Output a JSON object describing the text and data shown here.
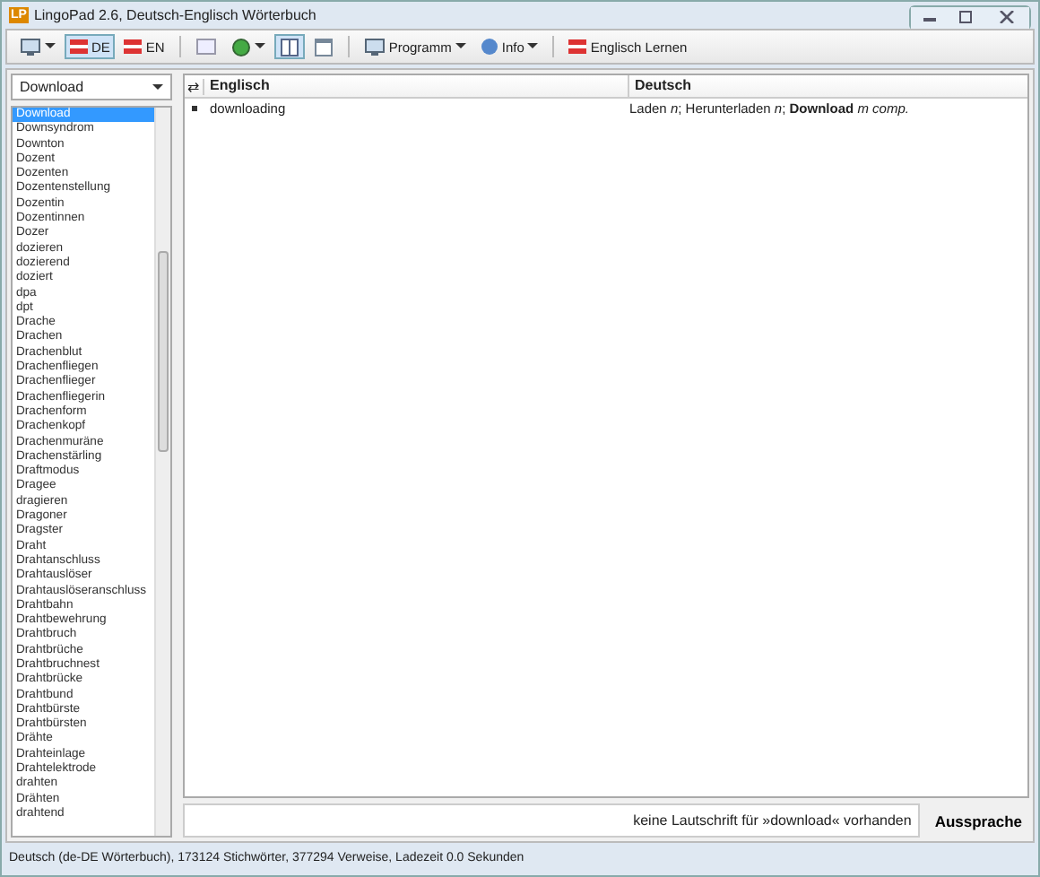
{
  "window": {
    "title": "LingoPad 2.6, Deutsch-Englisch Wörterbuch",
    "app_badge": "LP"
  },
  "toolbar": [
    {
      "kind": "icon-menu",
      "selected": false
    },
    {
      "kind": "lang",
      "label": "DE",
      "selected": true
    },
    {
      "kind": "lang",
      "label": "EN",
      "selected": false
    },
    {
      "kind": "sep"
    },
    {
      "kind": "icon",
      "selected": false
    },
    {
      "kind": "icon-menu",
      "selected": false
    },
    {
      "kind": "icon",
      "selected": true
    },
    {
      "kind": "icon",
      "selected": false
    },
    {
      "kind": "sep"
    },
    {
      "kind": "text-menu",
      "label": "Programm"
    },
    {
      "kind": "text-menu",
      "label": "Info"
    },
    {
      "kind": "sep"
    },
    {
      "kind": "text",
      "label": "Englisch Lernen"
    }
  ],
  "search": {
    "value": "Download"
  },
  "word_list": [
    {
      "text": "Download",
      "selected": true
    },
    {
      "text": "Downsyndrom",
      "selected": false
    },
    {
      "text": "Downton",
      "selected": false
    },
    {
      "text": "Dozent",
      "selected": false
    },
    {
      "text": "Dozenten",
      "selected": false
    },
    {
      "text": "Dozentenstellung",
      "selected": false
    },
    {
      "text": "Dozentin",
      "selected": false
    },
    {
      "text": "Dozentinnen",
      "selected": false
    },
    {
      "text": "Dozer",
      "selected": false
    },
    {
      "text": "dozieren",
      "selected": false
    },
    {
      "text": "dozierend",
      "selected": false
    },
    {
      "text": "doziert",
      "selected": false
    },
    {
      "text": "dpa",
      "selected": false
    },
    {
      "text": "dpt",
      "selected": false
    },
    {
      "text": "Drache",
      "selected": false
    },
    {
      "text": "Drachen",
      "selected": false
    },
    {
      "text": "Drachenblut",
      "selected": false
    },
    {
      "text": "Drachenfliegen",
      "selected": false
    },
    {
      "text": "Drachenflieger",
      "selected": false
    },
    {
      "text": "Drachenfliegerin",
      "selected": false
    },
    {
      "text": "Drachenform",
      "selected": false
    },
    {
      "text": "Drachenkopf",
      "selected": false
    },
    {
      "text": "Drachenmuräne",
      "selected": false
    },
    {
      "text": "Drachenstärling",
      "selected": false
    },
    {
      "text": "Draftmodus",
      "selected": false
    },
    {
      "text": "Dragee",
      "selected": false
    },
    {
      "text": "dragieren",
      "selected": false
    },
    {
      "text": "Dragoner",
      "selected": false
    },
    {
      "text": "Dragster",
      "selected": false
    },
    {
      "text": "Draht",
      "selected": false
    },
    {
      "text": "Drahtanschluss",
      "selected": false
    },
    {
      "text": "Drahtauslöser",
      "selected": false
    },
    {
      "text": "Drahtauslöseranschluss",
      "selected": false
    },
    {
      "text": "Drahtbahn",
      "selected": false
    },
    {
      "text": "Drahtbewehrung",
      "selected": false
    },
    {
      "text": "Drahtbruch",
      "selected": false
    },
    {
      "text": "Drahtbrüche",
      "selected": false
    },
    {
      "text": "Drahtbruchnest",
      "selected": false
    },
    {
      "text": "Drahtbrücke",
      "selected": false
    },
    {
      "text": "Drahtbund",
      "selected": false
    },
    {
      "text": "Drahtbürste",
      "selected": false
    },
    {
      "text": "Drahtbürsten",
      "selected": false
    },
    {
      "text": "Drähte",
      "selected": false
    },
    {
      "text": "Drahteinlage",
      "selected": false
    },
    {
      "text": "Drahtelektrode",
      "selected": false
    },
    {
      "text": "drahten",
      "selected": false
    },
    {
      "text": "Drähten",
      "selected": false
    },
    {
      "text": "drahtend",
      "selected": false
    }
  ],
  "table": {
    "swap_icon": "⇄",
    "columns": [
      "Englisch",
      "Deutsch"
    ],
    "rows": [
      {
        "english": "downloading",
        "deutsch": "Laden *n*; Herunterladen *n*; **Download** *m* *comp.*"
      }
    ]
  },
  "phonetics": {
    "value": "keine Lautschrift für »download« vorhanden",
    "button": "Aussprache"
  },
  "status_bar": "Deutsch (de-DE Wörterbuch), 173124 Stichwörter, 377294 Verweise, Ladezeit 0.0 Sekunden"
}
